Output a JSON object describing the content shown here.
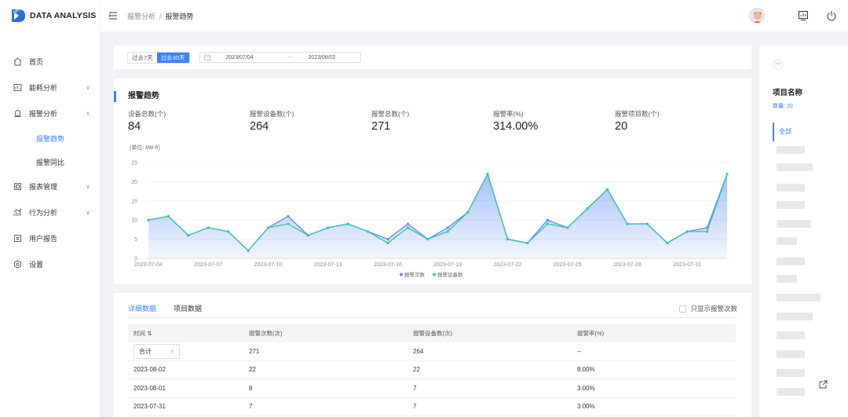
{
  "app": {
    "logo_text": "DATA ANALYSIS"
  },
  "breadcrumb": {
    "parent": "报警分析",
    "separator": "/",
    "current": "报警趋势"
  },
  "sidebar": {
    "items": [
      {
        "label": "首页",
        "icon": "home-icon"
      },
      {
        "label": "能耗分析",
        "icon": "monitor-icon"
      },
      {
        "label": "报警分析",
        "icon": "bell-icon",
        "expanded": true,
        "children": [
          {
            "label": "报警趋势",
            "active": true
          },
          {
            "label": "报警同比"
          }
        ]
      },
      {
        "label": "报表管理",
        "icon": "report-icon"
      },
      {
        "label": "行为分析",
        "icon": "behavior-icon"
      },
      {
        "label": "用户报告",
        "icon": "user-report-icon"
      },
      {
        "label": "设置",
        "icon": "settings-icon"
      }
    ]
  },
  "filter": {
    "range_buttons": [
      {
        "label": "过去7天"
      },
      {
        "label": "过去30天",
        "active": true
      }
    ],
    "date_start": "2023/07/04",
    "date_sep": "~",
    "date_end": "2023/08/02"
  },
  "trend": {
    "title": "报警趋势",
    "stats": [
      {
        "label": "设备总数(个)",
        "value": "84"
      },
      {
        "label": "报警设备数(个)",
        "value": "264"
      },
      {
        "label": "报警总数(个)",
        "value": "271"
      },
      {
        "label": "报警率(%)",
        "value": "314.00%"
      },
      {
        "label": "报警项目数(个)",
        "value": "20"
      }
    ],
    "unit": "(单位: kW-h)"
  },
  "chart_data": {
    "type": "area",
    "ylim": [
      0,
      25
    ],
    "yticks": [
      0,
      5,
      10,
      15,
      20,
      25
    ],
    "x": [
      "2023-07-04",
      "2023-07-05",
      "2023-07-06",
      "2023-07-07",
      "2023-07-08",
      "2023-07-09",
      "2023-07-10",
      "2023-07-11",
      "2023-07-12",
      "2023-07-13",
      "2023-07-14",
      "2023-07-15",
      "2023-07-16",
      "2023-07-17",
      "2023-07-18",
      "2023-07-19",
      "2023-07-20",
      "2023-07-21",
      "2023-07-22",
      "2023-07-23",
      "2023-07-24",
      "2023-07-25",
      "2023-07-26",
      "2023-07-27",
      "2023-07-28",
      "2023-07-29",
      "2023-07-30",
      "2023-07-31",
      "2023-08-01",
      "2023-08-02"
    ],
    "xtick_labels": [
      "2023-07-04",
      "2023-07-07",
      "2023-07-10",
      "2023-07-13",
      "2023-07-16",
      "2023-07-19",
      "2023-07-22",
      "2023-07-25",
      "2023-07-28",
      "2023-07-31"
    ],
    "series": [
      {
        "name": "报警次数",
        "color": "#5b8ff9",
        "values": [
          10,
          11,
          6,
          8,
          7,
          2,
          8,
          11,
          6,
          8,
          9,
          7,
          5,
          9,
          5,
          8,
          12,
          22,
          5,
          4,
          10,
          8,
          13,
          18,
          9,
          9,
          4,
          7,
          8,
          22
        ]
      },
      {
        "name": "报警设备数",
        "color": "#3cc6a5",
        "values": [
          10,
          11,
          6,
          8,
          7,
          2,
          8,
          9,
          6,
          8,
          9,
          7,
          4,
          8,
          5,
          7,
          12,
          22,
          5,
          4,
          9,
          8,
          13,
          18,
          9,
          9,
          4,
          7,
          7,
          22
        ]
      }
    ],
    "legend": "bottom-center"
  },
  "detail": {
    "tabs": [
      {
        "label": "详细数据",
        "active": true
      },
      {
        "label": "项目数据"
      }
    ],
    "only_alarm_label": "只显示报警次数",
    "columns": [
      "时间 ⇅",
      "报警次数(次)",
      "报警设备数(次)",
      "报警率(%)"
    ],
    "summary": {
      "select_label": "合计",
      "alarm_count": "271",
      "device_count": "264",
      "rate": "--"
    },
    "rows": [
      {
        "time": "2023-08-02",
        "alarm_count": "22",
        "device_count": "22",
        "rate": "8.00%"
      },
      {
        "time": "2023-08-01",
        "alarm_count": "8",
        "device_count": "7",
        "rate": "3.00%"
      },
      {
        "time": "2023-07-31",
        "alarm_count": "7",
        "device_count": "7",
        "rate": "3.00%"
      }
    ]
  },
  "right_panel": {
    "expand_label": ">>",
    "title": "项目名称",
    "count_label": "数量: 20",
    "all_label": "全部"
  }
}
